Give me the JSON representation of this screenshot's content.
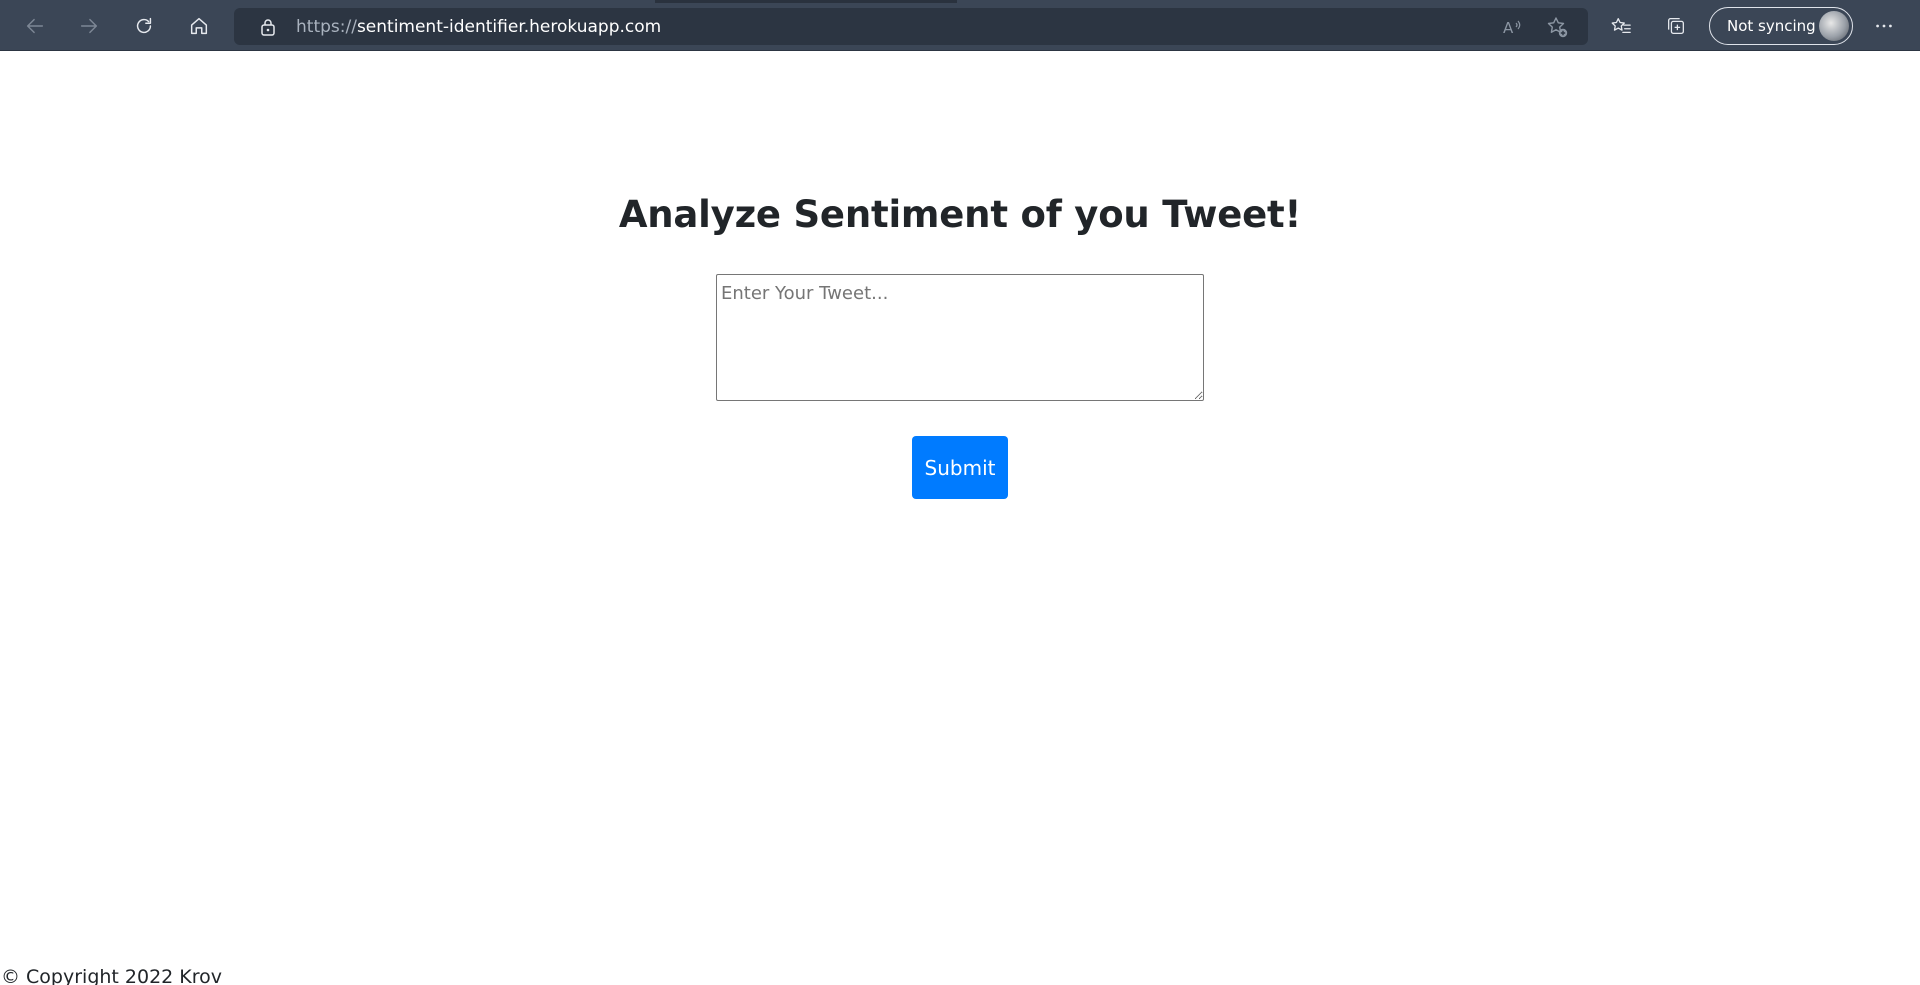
{
  "browser": {
    "url_scheme": "https://",
    "url_host": "sentiment-identifier.herokuapp.com",
    "sync_label": "Not syncing",
    "icons": [
      "back-icon",
      "forward-icon",
      "refresh-icon",
      "home-icon",
      "lock-icon",
      "read-aloud-icon",
      "add-favorite-icon",
      "favorites-icon",
      "collections-icon",
      "more-icon"
    ]
  },
  "main": {
    "title": "Analyze Sentiment of you Tweet!",
    "tweet_placeholder": "Enter Your Tweet...",
    "tweet_value": "",
    "submit_label": "Submit"
  },
  "footer": {
    "copyright": "© Copyright 2022 Krov"
  },
  "colors": {
    "toolbar_bg": "#3b4656",
    "address_bg": "#2c3542",
    "submit_bg": "#007bff",
    "title_text": "#212529"
  }
}
